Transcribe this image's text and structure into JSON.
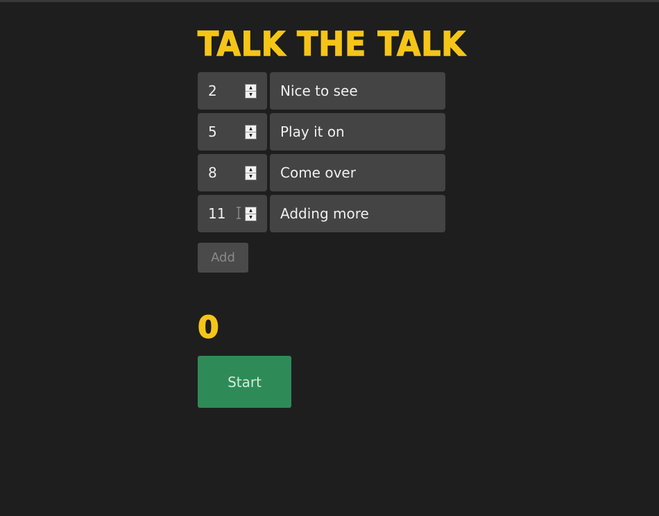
{
  "app": {
    "title": "TALK THE TALK"
  },
  "rows": [
    {
      "number": "2",
      "phrase": "Nice to see"
    },
    {
      "number": "5",
      "phrase": "Play it on"
    },
    {
      "number": "8",
      "phrase": "Come over"
    },
    {
      "number": "11",
      "phrase": "Adding more"
    }
  ],
  "controls": {
    "add_label": "Add",
    "start_label": "Start"
  },
  "score": "0",
  "colors": {
    "background": "#1e1e1e",
    "accent": "#f5c518",
    "field": "#444444",
    "start_button": "#2e8b57",
    "add_button": "#4a4a4a"
  },
  "icons": {
    "spinner_up": "spinner-up-icon",
    "spinner_down": "spinner-down-icon",
    "text_cursor": "text-cursor-icon"
  }
}
